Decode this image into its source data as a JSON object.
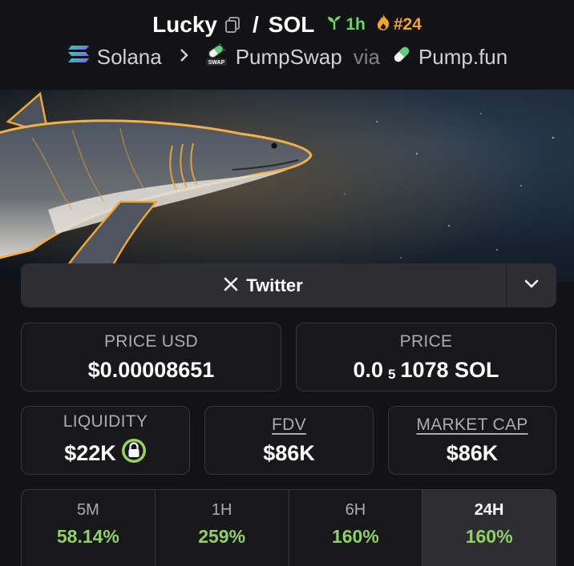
{
  "header": {
    "token_name": "Lucky",
    "separator": "/",
    "quote_token": "SOL",
    "age": "1h",
    "rank": "#24",
    "chain": "Solana",
    "dex": "PumpSwap",
    "via": "via",
    "launchpad": "Pump.fun"
  },
  "socials": {
    "twitter_label": "Twitter"
  },
  "stats": {
    "price_usd": {
      "label": "PRICE USD",
      "value": "$0.00008651"
    },
    "price_native": {
      "label": "PRICE",
      "prefix": "0.0",
      "zeros": "5",
      "suffix": "1078 SOL"
    },
    "liquidity": {
      "label": "LIQUIDITY",
      "value": "$22K"
    },
    "fdv": {
      "label": "FDV",
      "value": "$86K"
    },
    "market_cap": {
      "label": "MARKET CAP",
      "value": "$86K"
    }
  },
  "timeframes": [
    {
      "label": "5M",
      "change": "58.14%",
      "active": false
    },
    {
      "label": "1H",
      "change": "259%",
      "active": false
    },
    {
      "label": "6H",
      "change": "160%",
      "active": false
    },
    {
      "label": "24H",
      "change": "160%",
      "active": true
    }
  ],
  "colors": {
    "positive": "#8fd06a",
    "age_green": "#6ed36a",
    "rank_orange": "#f5a524",
    "card_border": "#35363b"
  }
}
